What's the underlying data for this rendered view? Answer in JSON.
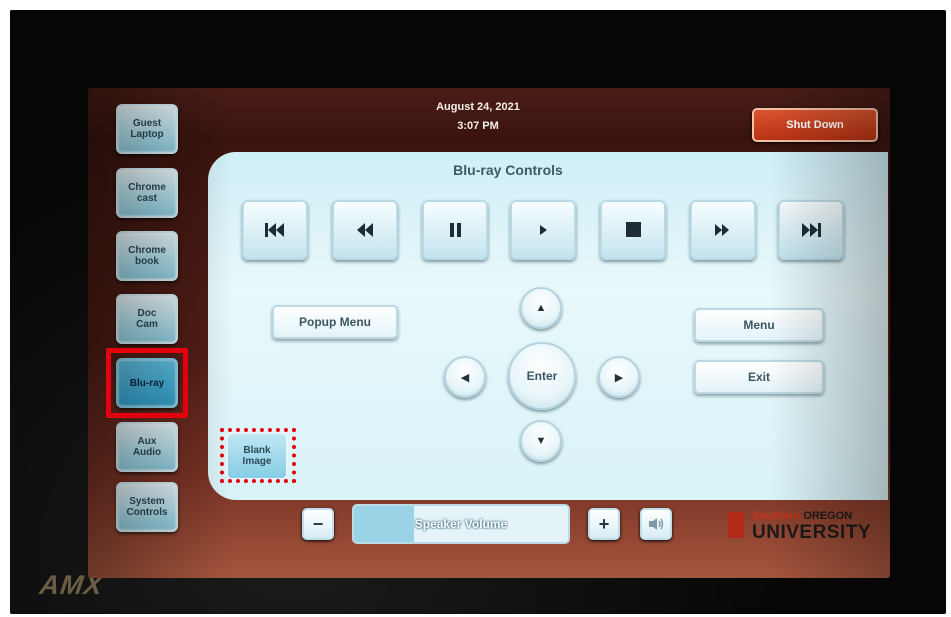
{
  "device": {
    "brand": "AMX"
  },
  "header": {
    "date": "August 24, 2021",
    "time": "3:07 PM",
    "shutdown_label": "Shut Down"
  },
  "sources": [
    {
      "label": "Guest\nLaptop",
      "active": false
    },
    {
      "label": "Chrome\ncast",
      "active": false
    },
    {
      "label": "Chrome\nbook",
      "active": false
    },
    {
      "label": "Doc\nCam",
      "active": false
    },
    {
      "label": "Blu-ray",
      "active": true
    },
    {
      "label": "Aux\nAudio",
      "active": false
    },
    {
      "label": "System\nControls",
      "active": false
    }
  ],
  "panel": {
    "title": "Blu-ray Controls",
    "transport": [
      "skip-back-icon",
      "rewind-icon",
      "pause-icon",
      "play-icon",
      "stop-icon",
      "fast-forward-icon",
      "skip-forward-icon"
    ],
    "popup_menu_label": "Popup Menu",
    "menu_label": "Menu",
    "exit_label": "Exit",
    "enter_label": "Enter",
    "blank_image_label": "Blank\nImage"
  },
  "volume": {
    "label": "Speaker Volume",
    "level": 0.28
  },
  "logo": {
    "line1_a": "Southern",
    "line1_b": "OREGON",
    "line2": "UNIVERSITY"
  },
  "colors": {
    "active_source": "#34a3d0",
    "shutdown": "#c03a18",
    "highlight": "#e3000f"
  }
}
